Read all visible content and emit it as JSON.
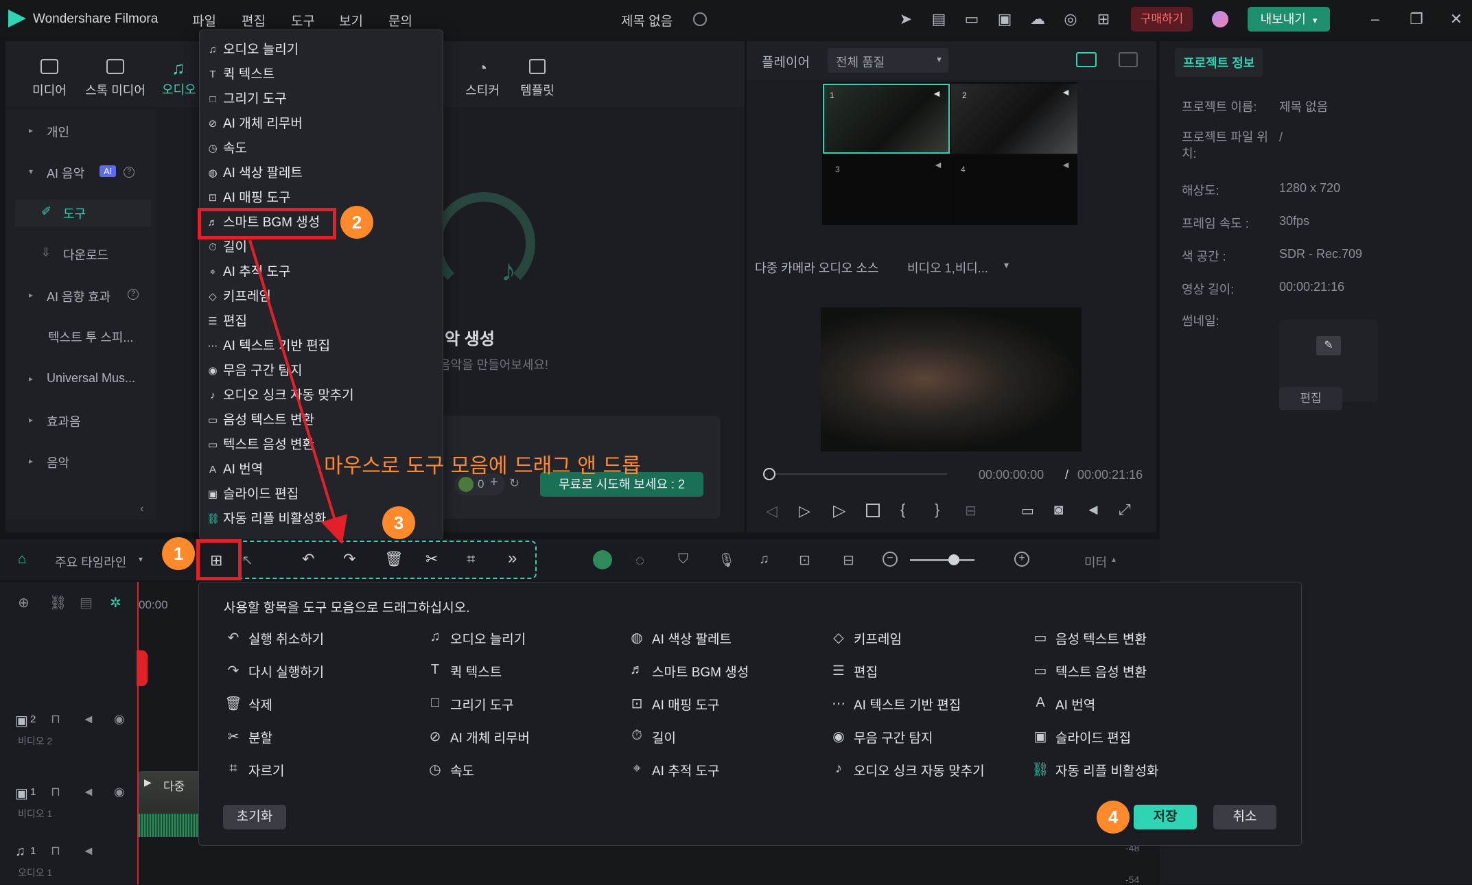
{
  "app": {
    "name": "Wondershare Filmora",
    "project_title": "제목 없음"
  },
  "menu": [
    "파일",
    "편집",
    "도구",
    "보기",
    "문의"
  ],
  "titlebar": {
    "buy_label": "구매하기",
    "export_label": "내보내기"
  },
  "media_tabs": [
    "미디어",
    "스톡 미디어",
    "오디오",
    "스티커",
    "템플릿"
  ],
  "sidebar": {
    "items": [
      "개인",
      "AI 음악",
      "도구",
      "다운로드",
      "AI 음향 효과",
      "텍스트 투 스피...",
      "Universal Mus...",
      "효과음",
      "음악"
    ],
    "ai_badge": "AI"
  },
  "center_panel": {
    "title_suffix": "악 생성",
    "subtitle": "음악을 만들어보세요!",
    "count": "0",
    "try_label": "무료로 시도해 보세요 : 2"
  },
  "dropdown": {
    "items": [
      "오디오 늘리기",
      "퀵 텍스트",
      "그리기 도구",
      "AI 개체 리무버",
      "속도",
      "AI 색상 팔레트",
      "AI 매핑 도구",
      "스마트 BGM 생성",
      "길이",
      "AI 추적 도구",
      "키프레임",
      "편집",
      "AI 텍스트 기반 편집",
      "무음 구간 탐지",
      "오디오 싱크 자동 맞추기",
      "음성 텍스트 변환",
      "텍스트 음성 변환",
      "AI 번역",
      "슬라이드 편집",
      "자동 리플 비활성화"
    ]
  },
  "annotation": {
    "drag_text": "마우스로 도구 모음에 드래그 앤 드롭",
    "badges": [
      "1",
      "2",
      "3",
      "4"
    ],
    "accent": "#ff8a2b",
    "highlight": "#e3202a"
  },
  "player": {
    "label": "플레이어",
    "quality": "전체 품질",
    "multicam_label": "다중 카메라 오디오 소스",
    "multicam_value": "비디오 1,비디...",
    "cams": [
      "1",
      "2",
      "3",
      "4"
    ],
    "current_time": "00:00:00:00",
    "separator": "/",
    "total_time": "00:00:21:16"
  },
  "project_info": {
    "tab": "프로젝트 정보",
    "rows": [
      {
        "label": "프로젝트 이름:",
        "value": "제목 없음"
      },
      {
        "label": "프로젝트 파일 위치:",
        "value": "/"
      },
      {
        "label": "해상도:",
        "value": "1280 x 720"
      },
      {
        "label": "프레임 속도 :",
        "value": "30fps"
      },
      {
        "label": "색 공간 :",
        "value": "SDR - Rec.709"
      },
      {
        "label": "영상 길이:",
        "value": "00:00:21:16"
      },
      {
        "label": "썸네일:",
        "value": ""
      }
    ],
    "edit_label": "편집"
  },
  "timeline": {
    "label": "주요 타임라인",
    "meter_label": "미터",
    "ruler_start": "00:00",
    "tracks": [
      "비디오 2",
      "비디오 1",
      "오디오 1"
    ],
    "track_numbers": [
      "2",
      "1",
      "1"
    ],
    "clip_label": "다중",
    "meter_values": [
      "-48",
      "-54"
    ]
  },
  "customize": {
    "instruction": "사용할 항목을 도구 모음으로 드래그하십시오.",
    "columns": [
      [
        "실행 취소하기",
        "다시 실행하기",
        "삭제",
        "분할",
        "자르기"
      ],
      [
        "오디오 늘리기",
        "퀵 텍스트",
        "그리기 도구",
        "AI 개체 리무버",
        "속도"
      ],
      [
        "AI 색상 팔레트",
        "스마트 BGM 생성",
        "AI 매핑 도구",
        "길이",
        "AI 추적 도구"
      ],
      [
        "키프레임",
        "편집",
        "AI 텍스트 기반 편집",
        "무음 구간 탐지",
        "오디오 싱크 자동 맞추기"
      ],
      [
        "음성 텍스트 변환",
        "텍스트 음성 변환",
        "AI 번역",
        "슬라이드 편집",
        "자동 리플 비활성화"
      ]
    ],
    "reset_label": "초기화",
    "save_label": "저장",
    "cancel_label": "취소"
  }
}
